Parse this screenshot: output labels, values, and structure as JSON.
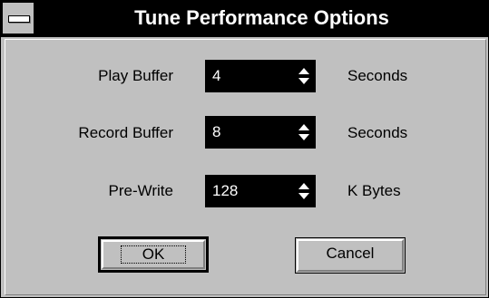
{
  "window": {
    "title": "Tune Performance Options",
    "system_menu_icon": "system-menu-icon"
  },
  "rows": [
    {
      "label": "Play Buffer",
      "value": "4",
      "unit": "Seconds"
    },
    {
      "label": "Record Buffer",
      "value": "8",
      "unit": "Seconds"
    },
    {
      "label": "Pre-Write",
      "value": "128",
      "unit": "K Bytes"
    }
  ],
  "buttons": {
    "ok_label": "OK",
    "cancel_label": "Cancel"
  },
  "colors": {
    "face": "#c0c0c0",
    "titlebar": "#000000",
    "field_bg": "#000000",
    "field_text": "#ffffff"
  }
}
